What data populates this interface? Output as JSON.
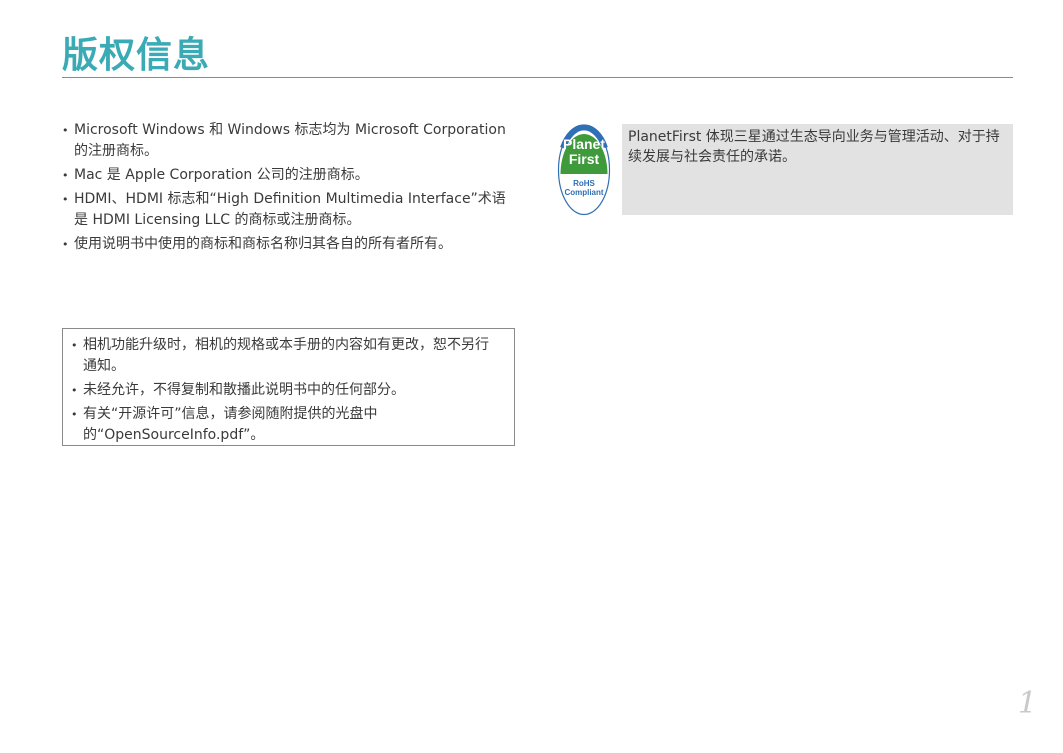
{
  "header": {
    "title": "版权信息"
  },
  "trademarks": [
    "Microsoft Windows 和 Windows 标志均为 Microsoft Corporation 的注册商标。",
    "Mac 是 Apple Corporation 公司的注册商标。",
    "HDMI、HDMI 标志和“High Definition Multimedia Interface”术语是 HDMI Licensing LLC 的商标或注册商标。",
    "使用说明书中使用的商标和商标名称归其各自的所有者所有。"
  ],
  "notices": [
    "相机功能升级时，相机的规格或本手册的内容如有更改，恕不另行通知。",
    "未经允许，不得复制和散播此说明书中的任何部分。",
    "有关“开源许可”信息，请参阅随附提供的光盘中的“OpenSourceInfo.pdf”。"
  ],
  "planet_first": {
    "logo_line1": "Planet",
    "logo_line2": "First",
    "logo_line3": "RoHS",
    "logo_line4": "Compliant",
    "description": "PlanetFirst 体现三星通过生态导向业务与管理活动、对于持续发展与社会责任的承诺。",
    "logo_green": "#3f9a3c",
    "logo_blue": "#2e6fb5"
  },
  "footer": {
    "page_number": "1"
  }
}
